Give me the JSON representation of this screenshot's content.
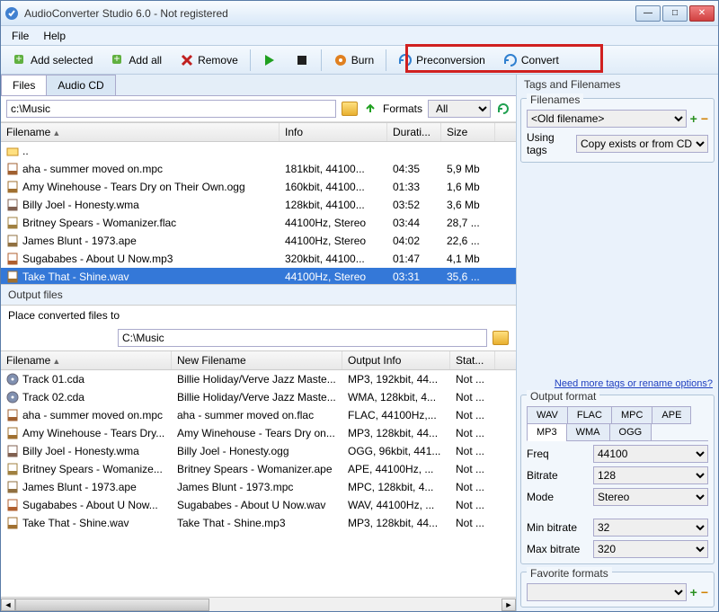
{
  "title": "AudioConverter Studio 6.0 - Not registered",
  "menu": {
    "file": "File",
    "help": "Help"
  },
  "toolbar": {
    "add_selected": "Add selected",
    "add_all": "Add all",
    "remove": "Remove",
    "burn": "Burn",
    "preconversion": "Preconversion",
    "convert": "Convert"
  },
  "tabs": {
    "files": "Files",
    "audiocd": "Audio CD"
  },
  "pathrow": {
    "path": "c:\\Music",
    "formats_label": "Formats",
    "formats_value": "All"
  },
  "input_cols": {
    "filename": "Filename",
    "info": "Info",
    "duration": "Durati...",
    "size": "Size"
  },
  "input_col_widths": {
    "filename": "310px",
    "info": "120px",
    "duration": "60px",
    "size": "60px"
  },
  "input_rows": [
    {
      "icon": "folder-up",
      "name": "..",
      "info": "",
      "dur": "",
      "size": ""
    },
    {
      "icon": "mpc",
      "name": "aha - summer moved on.mpc",
      "info": "181kbit, 44100...",
      "dur": "04:35",
      "size": "5,9 Mb"
    },
    {
      "icon": "ogg",
      "name": "Amy Winehouse - Tears Dry on Their Own.ogg",
      "info": "160kbit, 44100...",
      "dur": "01:33",
      "size": "1,6 Mb"
    },
    {
      "icon": "wma",
      "name": "Billy Joel - Honesty.wma",
      "info": "128kbit, 44100...",
      "dur": "03:52",
      "size": "3,6 Mb"
    },
    {
      "icon": "flac",
      "name": "Britney Spears - Womanizer.flac",
      "info": "44100Hz, Stereo",
      "dur": "03:44",
      "size": "28,7 ..."
    },
    {
      "icon": "ape",
      "name": "James Blunt - 1973.ape",
      "info": "44100Hz, Stereo",
      "dur": "04:02",
      "size": "22,6 ..."
    },
    {
      "icon": "mp3",
      "name": "Sugababes - About U Now.mp3",
      "info": "320kbit, 44100...",
      "dur": "01:47",
      "size": "4,1 Mb"
    },
    {
      "icon": "wav",
      "name": "Take That - Shine.wav",
      "info": "44100Hz, Stereo",
      "dur": "03:31",
      "size": "35,6 ...",
      "selected": true
    }
  ],
  "output_title": "Output files",
  "place_label": "Place converted files to",
  "output_path": "C:\\Music",
  "output_cols": {
    "filename": "Filename",
    "newfile": "New Filename",
    "outinfo": "Output Info",
    "status": "Stat..."
  },
  "output_col_widths": {
    "filename": "190px",
    "newfile": "190px",
    "outinfo": "120px",
    "status": "50px"
  },
  "output_rows": [
    {
      "icon": "cd",
      "name": "Track 01.cda",
      "newf": "Billie Holiday/Verve Jazz Maste...",
      "out": "MP3, 192kbit, 44...",
      "st": "Not ..."
    },
    {
      "icon": "cd",
      "name": "Track 02.cda",
      "newf": "Billie Holiday/Verve Jazz Maste...",
      "out": "WMA, 128kbit, 4...",
      "st": "Not ..."
    },
    {
      "icon": "mpc",
      "name": "aha - summer moved on.mpc",
      "newf": "aha - summer moved on.flac",
      "out": "FLAC, 44100Hz,...",
      "st": "Not ..."
    },
    {
      "icon": "ogg",
      "name": "Amy Winehouse - Tears Dry...",
      "newf": "Amy Winehouse - Tears Dry on...",
      "out": "MP3, 128kbit, 44...",
      "st": "Not ..."
    },
    {
      "icon": "wma",
      "name": "Billy Joel - Honesty.wma",
      "newf": "Billy Joel - Honesty.ogg",
      "out": "OGG, 96kbit, 441...",
      "st": "Not ..."
    },
    {
      "icon": "flac",
      "name": "Britney Spears - Womanize...",
      "newf": "Britney Spears - Womanizer.ape",
      "out": "APE, 44100Hz, ...",
      "st": "Not ..."
    },
    {
      "icon": "ape",
      "name": "James Blunt - 1973.ape",
      "newf": "James Blunt - 1973.mpc",
      "out": "MPC, 128kbit, 4...",
      "st": "Not ..."
    },
    {
      "icon": "mp3",
      "name": "Sugababes - About U Now...",
      "newf": "Sugababes - About U Now.wav",
      "out": "WAV, 44100Hz, ...",
      "st": "Not ..."
    },
    {
      "icon": "wav",
      "name": "Take That - Shine.wav",
      "newf": "Take That - Shine.mp3",
      "out": "MP3, 128kbit, 44...",
      "st": "Not ..."
    }
  ],
  "right": {
    "tags_title": "Tags and Filenames",
    "filenames_title": "Filenames",
    "filenames_value": "<Old filename>",
    "using_tags_label": "Using tags",
    "using_tags_value": "Copy exists or from CD",
    "more_link": "Need more tags or rename options?",
    "output_format_title": "Output format",
    "fmt_tabs_top": [
      "WAV",
      "FLAC",
      "MPC",
      "APE"
    ],
    "fmt_tabs_bottom": [
      "MP3",
      "WMA",
      "OGG"
    ],
    "fmt_active": "MP3",
    "freq_label": "Freq",
    "freq_value": "44100",
    "bitrate_label": "Bitrate",
    "bitrate_value": "128",
    "mode_label": "Mode",
    "mode_value": "Stereo",
    "min_br_label": "Min bitrate",
    "min_br_value": "32",
    "max_br_label": "Max bitrate",
    "max_br_value": "320",
    "fav_title": "Favorite formats"
  }
}
